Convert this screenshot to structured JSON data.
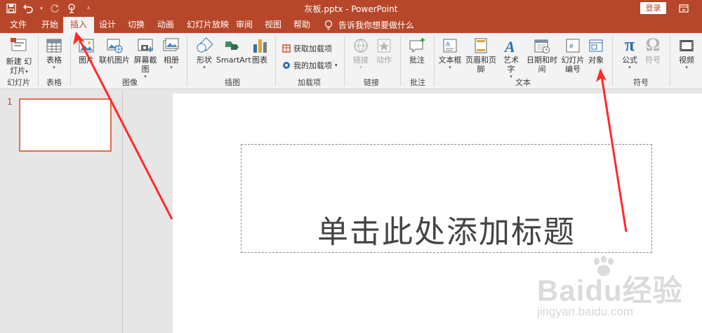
{
  "titlebar": {
    "doc_title": "灰板.pptx - PowerPoint",
    "login": "登录",
    "quick_access": [
      "save-icon",
      "undo-icon",
      "redo-icon",
      "touch-mode-icon",
      "customize-icon"
    ]
  },
  "tabs": [
    "文件",
    "开始",
    "插入",
    "设计",
    "切换",
    "动画",
    "幻灯片放映",
    "审阅",
    "视图",
    "帮助"
  ],
  "active_tab": "插入",
  "tell_me": "告诉我你想要做什么",
  "ribbon": {
    "slides": {
      "new_slide_1": "新建",
      "new_slide_2": "幻灯片",
      "group": "幻灯片"
    },
    "tables": {
      "table": "表格",
      "group": "表格"
    },
    "images": {
      "picture": "图片",
      "online_picture": "联机图片",
      "screenshot": "屏幕截图",
      "album": "相册",
      "group": "图像"
    },
    "illustrations": {
      "shapes": "形状",
      "smartart": "SmartArt",
      "chart": "图表",
      "group": "插图"
    },
    "addins": {
      "get": "获取加载项",
      "my": "我的加载项",
      "group": "加载项"
    },
    "links": {
      "link": "链接",
      "action": "动作",
      "group": "链接"
    },
    "comments": {
      "comment": "批注",
      "group": "批注"
    },
    "text": {
      "textbox": "文本框",
      "header_footer": "页眉和页脚",
      "wordart": "艺术字",
      "datetime": "日期和时间",
      "slide_num_1": "幻灯片",
      "slide_num_2": "编号",
      "object": "对象",
      "group": "文本"
    },
    "symbols": {
      "equation": "公式",
      "symbol": "符号",
      "group": "符号"
    },
    "media": {
      "video": "视频"
    }
  },
  "thumbs": {
    "slide_number": "1"
  },
  "slide": {
    "title_placeholder": "单击此处添加标题"
  },
  "watermark": {
    "brand": "Baidu经验",
    "url": "jingyan.baidu.com"
  },
  "colors": {
    "accent": "#b7472a",
    "arrow": "#ff2a2a"
  }
}
